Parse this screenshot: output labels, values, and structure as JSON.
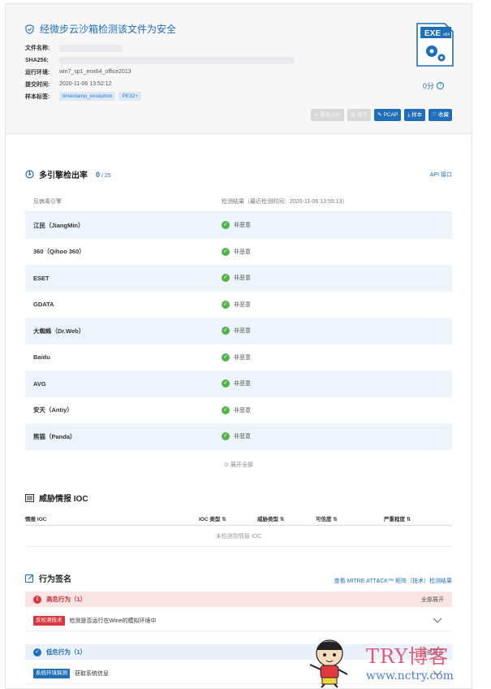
{
  "header": {
    "verdict": "经微步云沙箱检测该文件为安全",
    "meta": [
      {
        "key": "文件名称:",
        "value": ""
      },
      {
        "key": "SHA256:",
        "value": ""
      },
      {
        "key": "运行环境:",
        "value": "win7_sp1_enx64_office2013"
      },
      {
        "key": "提交时间:",
        "value": "2020-11-06 13:52:12"
      }
    ],
    "tags_label": "样本标签:",
    "tags": [
      "timestamp_exception",
      "PE32+"
    ],
    "file_type": "EXE",
    "file_arch": "x64",
    "score": "0分",
    "score_help": "?",
    "actions": {
      "reanalyze": "重新分析",
      "report": "报告",
      "pcap": "PCAP",
      "sample": "样本",
      "favorite": "收藏"
    }
  },
  "engines": {
    "title": "多引擎检出率",
    "detected": "0",
    "total": "/ 25",
    "api_link": "API 接口",
    "col_engine": "反病毒引擎",
    "col_result": "检测结果（最近检测时间：2020-11-06 13:55:13）",
    "rows": [
      {
        "name": "江民（JiangMin）",
        "result": "非恶意"
      },
      {
        "name": "360（Qihoo 360）",
        "result": "非恶意"
      },
      {
        "name": "ESET",
        "result": "非恶意"
      },
      {
        "name": "GDATA",
        "result": "非恶意"
      },
      {
        "name": "大蜘蛛（Dr.Web）",
        "result": "非恶意"
      },
      {
        "name": "Baidu",
        "result": "非恶意"
      },
      {
        "name": "AVG",
        "result": "非恶意"
      },
      {
        "name": "安天（Antiy）",
        "result": "非恶意"
      },
      {
        "name": "熊猫（Panda）",
        "result": "非恶意"
      }
    ],
    "expand_all": "展开全部"
  },
  "ioc": {
    "title": "威胁情报 IOC",
    "columns": [
      "情报 IOC",
      "IOC 类型",
      "威胁类型",
      "可信度",
      "严重程度"
    ],
    "empty": "未检测到情报 IOC"
  },
  "behavior": {
    "title": "行为签名",
    "mitre_link": "查看 MITRE ATT&CK™ 矩阵（技术）检测结果",
    "high": {
      "label": "高危行为（1）",
      "expand": "全部展开",
      "chip": "反检测技术",
      "desc": "检测是否运行在Wine的模拟环境中"
    },
    "low": {
      "label": "低危行为（1）",
      "expand": "全部展开",
      "chip": "系统环境探测",
      "desc": "获取系统信息"
    }
  },
  "watermark": {
    "brand": "TRY博客",
    "url": "www.nctry.com"
  }
}
